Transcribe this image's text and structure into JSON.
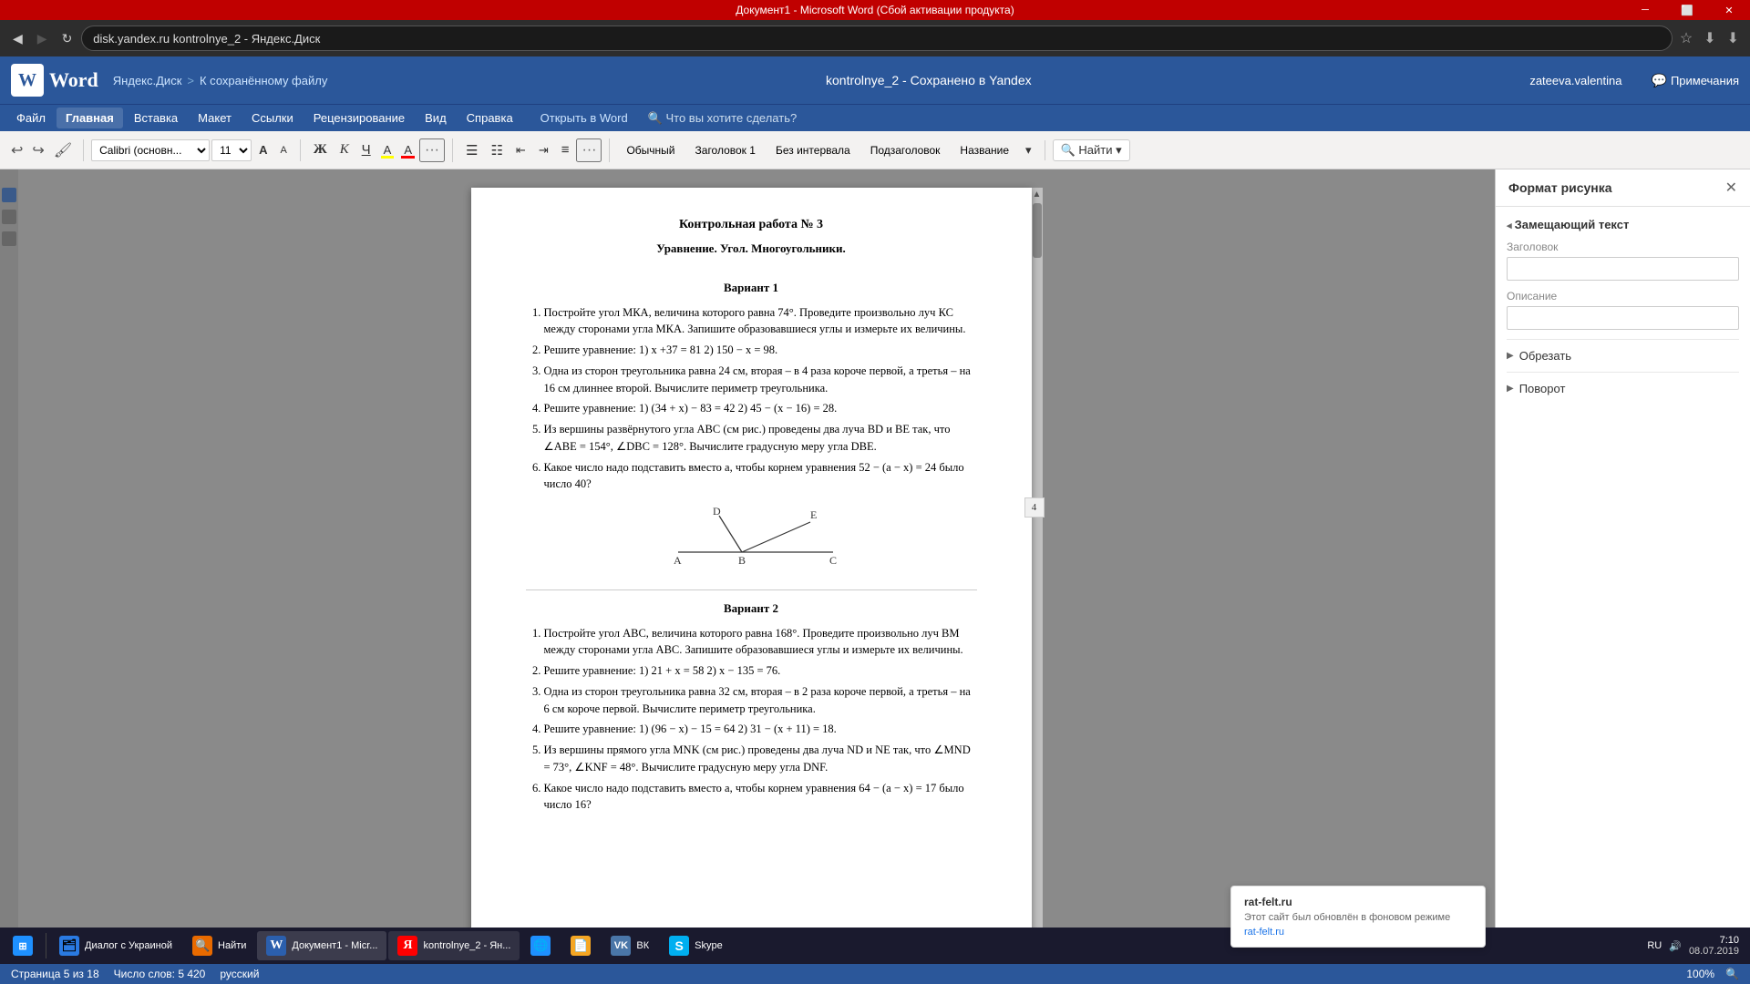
{
  "titleBar": {
    "text": "Документ1 - Microsoft Word (Сбой активации продукта)",
    "minimize": "🗕",
    "restore": "🗗",
    "close": "✕"
  },
  "browserBar": {
    "back": "←",
    "forward": "→",
    "reload": "↻",
    "address": "disk.yandex.ru  kontrolnye_2 - Яндекс.Диск"
  },
  "wordHeader": {
    "logoLetter": "W",
    "appName": "Word",
    "breadcrumb1": "Яндекс.Диск",
    "breadcrumbSep": ">",
    "breadcrumb2": "К сохранённому файлу",
    "fileTitle": "kontrolnye_2  -  Сохранено в Yandex",
    "userName": "zateeva.valentina",
    "notesBtn": "Примечания"
  },
  "menuBar": {
    "items": [
      "Файл",
      "Главная",
      "Вставка",
      "Макет",
      "Ссылки",
      "Рецензирование",
      "Вид",
      "Справка"
    ],
    "activeItem": "Главная",
    "openInWord": "Открыть в Word",
    "searchPlaceholder": "Что вы хотите сделать?"
  },
  "toolbar": {
    "undo": "↩",
    "redo": "↪",
    "format": "🖌",
    "font": "Calibri (основн...",
    "fontSize": "11",
    "increaseFont": "A",
    "decreaseFont": "A",
    "bold": "Ж",
    "italic": "К",
    "underline": "Ч",
    "highlight": "A",
    "fontColor": "A",
    "more1": "...",
    "listBullet": "☰",
    "listNumber": "☷",
    "indent": "⇥",
    "outdent": "⇤",
    "align": "≡",
    "more2": "...",
    "styles": [
      "Обычный",
      "Заголовок 1",
      "Без интервала",
      "Подзаголовок",
      "Название"
    ],
    "dropStyle": "▾",
    "find": "🔍 Найти"
  },
  "document": {
    "title1": "Контрольная работа № 3",
    "title2": "Уравнение. Угол. Многоугольники.",
    "variant1": {
      "header": "Вариант  1",
      "items": [
        "Постройте угол МКА, величина которого равна 74°. Проведите произвольно луч КС между сторонами угла МКА. Запишите образовавшиеся углы и измерьте их величины.",
        "Решите уравнение:    1) x +37 = 81        2) 150 − x = 98.",
        "Одна из сторон треугольника равна 24 см, вторая – в 4 раза короче первой, а третья – на 16 см длиннее второй. Вычислите периметр треугольника.",
        "Решите уравнение:    1) (34 + x) − 83 = 42    2) 45 − (x − 16) = 28.",
        "Из вершины развёрнутого угла АВС (см рис.) проведены два луча BD и BE так, что ∠ABE = 154°, ∠DBC = 128°. Вычислите градусную меру угла DBE.",
        "Какое число надо подставить вместо a, чтобы корнем уравнения 52 − (a − x) = 24 было число 40?"
      ]
    },
    "variant2": {
      "header": "Вариант  2",
      "items": [
        "Постройте угол АВС, величина которого равна 168°. Проведите произвольно луч ВМ между сторонами угла АВС. Запишите образовавшиеся углы и измерьте их величины.",
        "Решите уравнение:    1) 21 + x = 58        2) x − 135 = 76.",
        "Одна из сторон треугольника равна 32 см, вторая – в 2 раза короче первой, а третья – на 6 см короче первой. Вычислите периметр треугольника.",
        "Решите уравнение:    1) (96 − x) − 15 = 64    2) 31 − (x + 11) = 18.",
        "Из вершины прямого угла МNK (см рис.) проведены два луча ND и NE так, что ∠MND = 73°, ∠KNF = 48°. Вычислите градусную меру угла DNF.",
        "Какое число надо подставить вместо a, чтобы корнем уравнения 64 − (a − x) = 17 было число 16?"
      ]
    }
  },
  "rightPanel": {
    "title": "Формат рисунка",
    "closeBtn": "✕",
    "section1": "Замещающий текст",
    "field1Label": "Заголовок",
    "field1Placeholder": "",
    "field2Label": "Описание",
    "field2Placeholder": "",
    "section2": "Обрезать",
    "section3": "Поворот"
  },
  "scrollbar": {
    "pageNum": "4"
  },
  "notification": {
    "title": "rat-felt.ru",
    "text": "Этот сайт был обновлён в фоновом режиме",
    "site": "rat-felt.ru"
  },
  "statusBar": {
    "page": "Страница 5 из 18",
    "words": "Число слов: 5 420",
    "lang": "русский",
    "zoom": "100%",
    "zoomMode": "100%"
  },
  "taskbar": {
    "items": [
      {
        "icon": "🗂",
        "label": "Диалог с Украиной",
        "color": "#2a7ae2"
      },
      {
        "icon": "🔍",
        "label": "Найти",
        "color": "#e86a00"
      },
      {
        "icon": "W",
        "label": "Документ1 - Micr...",
        "color": "#2b5fad"
      },
      {
        "icon": "Я",
        "label": "kontrolnye_2 - Ян...",
        "color": "#f00"
      },
      {
        "icon": "🌐",
        "label": "",
        "color": "#1e90ff"
      },
      {
        "icon": "📄",
        "label": "",
        "color": "#f5a623"
      },
      {
        "icon": "VK",
        "label": "ВК",
        "color": "#4a76a8"
      },
      {
        "icon": "S",
        "label": "Skype",
        "color": "#00aff0"
      }
    ],
    "time": "7:10",
    "date": "08.07.2019",
    "lang": "RU"
  },
  "diagram": {
    "points": {
      "A": "A",
      "B": "B",
      "C": "C",
      "D": "D",
      "E": "E"
    }
  }
}
